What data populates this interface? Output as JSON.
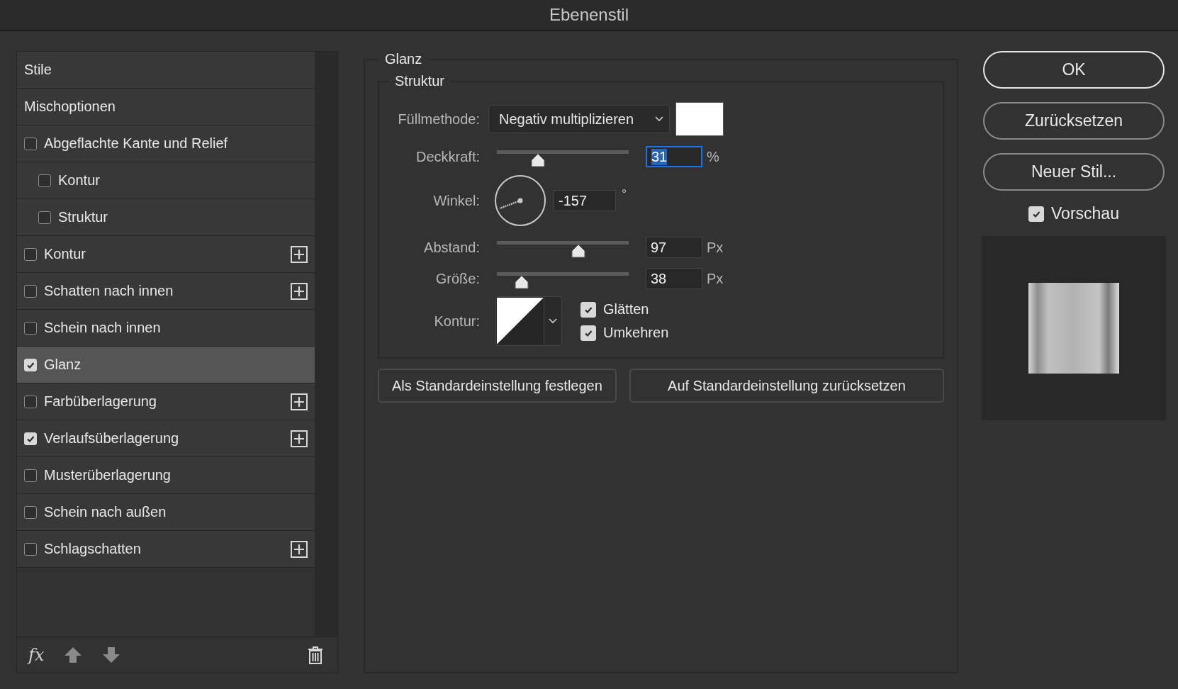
{
  "window": {
    "title": "Ebenenstil"
  },
  "sidebar": {
    "items": [
      {
        "kind": "header",
        "label": "Stile",
        "selected": false
      },
      {
        "kind": "header",
        "label": "Mischoptionen",
        "selected": false
      },
      {
        "kind": "checkbox",
        "label": "Abgeflachte Kante und Relief",
        "checked": false,
        "selected": false,
        "children": [
          {
            "kind": "checkbox",
            "label": "Kontur",
            "checked": false,
            "selected": false
          },
          {
            "kind": "checkbox",
            "label": "Struktur",
            "checked": false,
            "selected": false
          }
        ]
      },
      {
        "kind": "checkbox",
        "label": "Kontur",
        "checked": false,
        "selected": false,
        "addable": true
      },
      {
        "kind": "checkbox",
        "label": "Schatten nach innen",
        "checked": false,
        "selected": false,
        "addable": true
      },
      {
        "kind": "checkbox",
        "label": "Schein nach innen",
        "checked": false,
        "selected": false
      },
      {
        "kind": "checkbox",
        "label": "Glanz",
        "checked": true,
        "selected": true
      },
      {
        "kind": "checkbox",
        "label": "Farbüberlagerung",
        "checked": false,
        "selected": false,
        "addable": true
      },
      {
        "kind": "checkbox",
        "label": "Verlaufsüberlagerung",
        "checked": true,
        "selected": false,
        "addable": true
      },
      {
        "kind": "checkbox",
        "label": "Musterüberlagerung",
        "checked": false,
        "selected": false
      },
      {
        "kind": "checkbox",
        "label": "Schein nach außen",
        "checked": false,
        "selected": false
      },
      {
        "kind": "checkbox",
        "label": "Schlagschatten",
        "checked": false,
        "selected": false,
        "addable": true
      }
    ],
    "footer": {
      "fx": "fx"
    }
  },
  "panel": {
    "title": "Glanz",
    "section": "Struktur",
    "fields": [
      {
        "kind": "select",
        "label": "Füllmethode:",
        "value": "Negativ multiplizieren",
        "color": "#ffffff"
      },
      {
        "kind": "slider",
        "label": "Deckkraft:",
        "level": 0.31,
        "value": "31",
        "unit": "%",
        "focused": true
      },
      {
        "kind": "angle",
        "label": "Winkel:",
        "value": "-157",
        "unit": "°"
      },
      {
        "kind": "slider",
        "label": "Abstand:",
        "level": 0.62,
        "value": "97",
        "unit": "Px",
        "focused": false
      },
      {
        "kind": "slider",
        "label": "Größe:",
        "level": 0.19,
        "value": "38",
        "unit": "Px",
        "focused": false
      },
      {
        "kind": "contour",
        "label": "Kontur:",
        "options": [
          {
            "label": "Glätten",
            "checked": true
          },
          {
            "label": "Umkehren",
            "checked": true
          }
        ]
      }
    ],
    "buttons": [
      "Als Standardeinstellung festlegen",
      "Auf Standardeinstellung zurücksetzen"
    ]
  },
  "actions": {
    "buttons": [
      {
        "label": "OK",
        "default": true
      },
      {
        "label": "Zurücksetzen",
        "default": false
      },
      {
        "label": "Neuer Stil...",
        "default": false
      }
    ],
    "preview": {
      "label": "Vorschau",
      "checked": true
    }
  }
}
